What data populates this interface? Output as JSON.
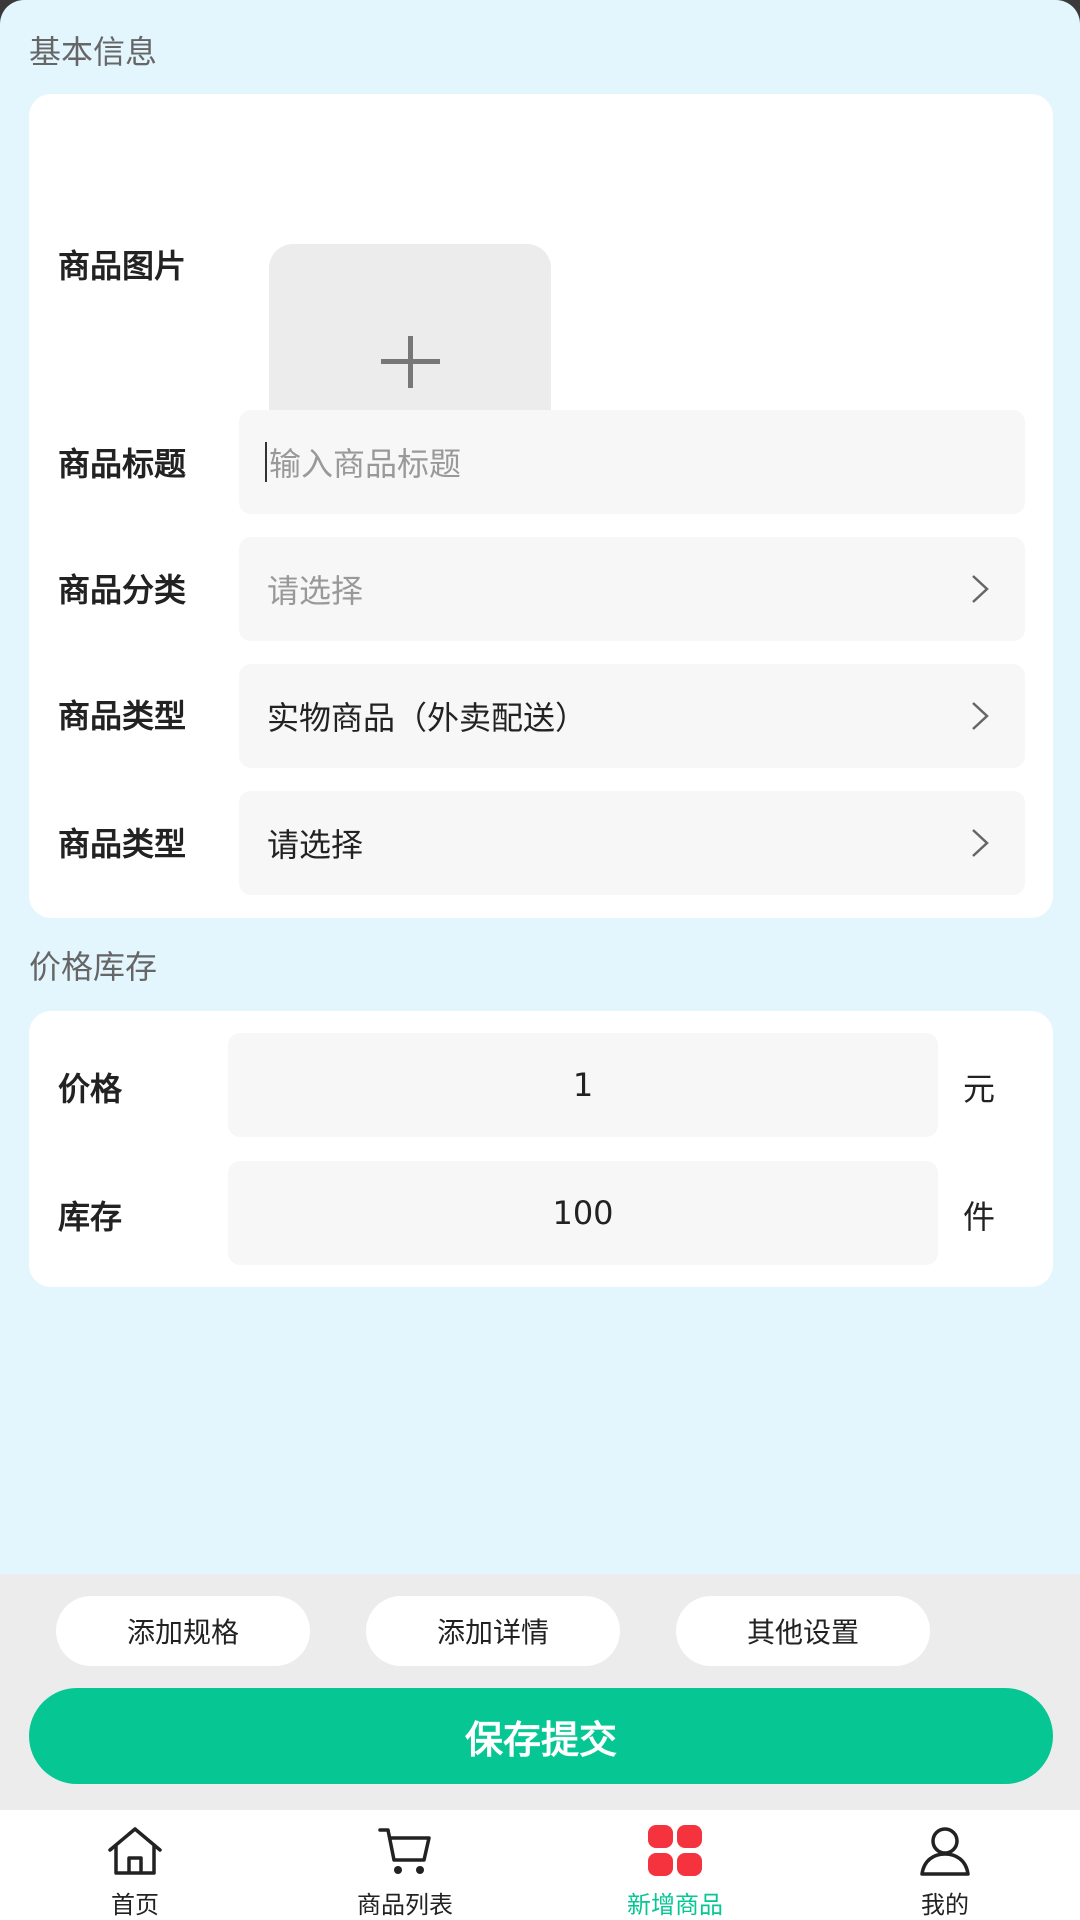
{
  "sections": {
    "basic_title": "基本信息",
    "price_title": "价格库存"
  },
  "basic": {
    "image_label": "商品图片",
    "title_label": "商品标题",
    "title_placeholder": "输入商品标题",
    "category_label": "商品分类",
    "category_value": "请选择",
    "type_label": "商品类型",
    "type_value": "实物商品（外卖配送）",
    "type2_label": "商品类型",
    "type2_value": "请选择"
  },
  "price": {
    "price_label": "价格",
    "price_value": "1",
    "price_unit": "元",
    "stock_label": "库存",
    "stock_value": "100",
    "stock_unit": "件"
  },
  "actions": {
    "add_spec": "添加规格",
    "add_detail": "添加详情",
    "other_settings": "其他设置",
    "submit": "保存提交"
  },
  "tabs": [
    {
      "label": "首页",
      "icon": "home-icon"
    },
    {
      "label": "商品列表",
      "icon": "cart-icon"
    },
    {
      "label": "新增商品",
      "icon": "grid-icon"
    },
    {
      "label": "我的",
      "icon": "user-icon"
    }
  ],
  "colors": {
    "accent": "#06c794",
    "active_icon": "#f5333f",
    "background": "#e3f5fd"
  }
}
